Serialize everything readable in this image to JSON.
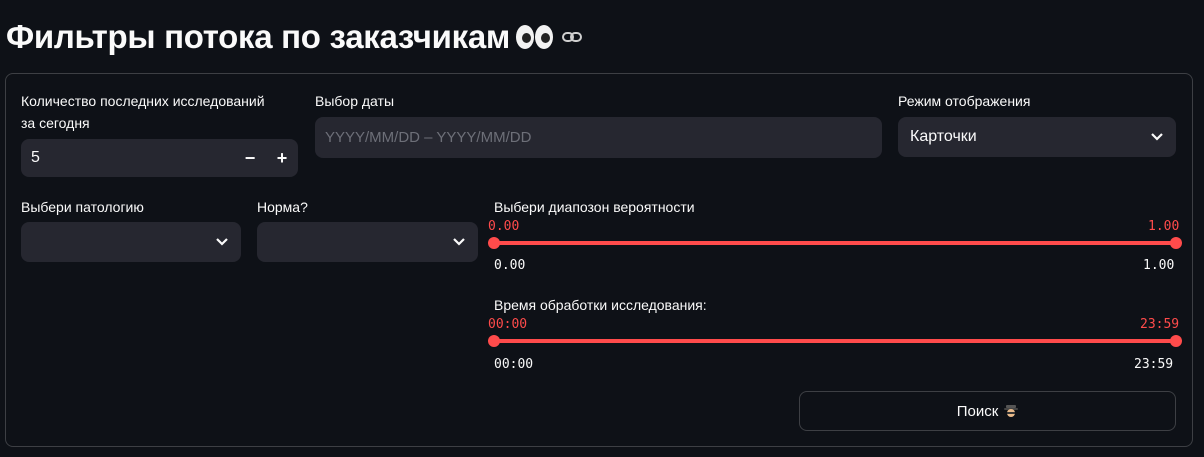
{
  "header": {
    "title": "Фильтры потока по заказчикам",
    "emoji_icon": "eyes-icon",
    "link_icon": "link-icon"
  },
  "filters": {
    "count": {
      "label": "Количество последних исследований за сегодня",
      "value": "5",
      "minus": "−",
      "plus": "+"
    },
    "date": {
      "label": "Выбор даты",
      "placeholder": "YYYY/MM/DD – YYYY/MM/DD"
    },
    "mode": {
      "label": "Режим отображения",
      "value": "Карточки"
    },
    "pathology": {
      "label": "Выбери патологию",
      "value": ""
    },
    "norm": {
      "label": "Норма?",
      "value": ""
    },
    "probability": {
      "label": "Выбери диапозон вероятности",
      "value_low": "0.00",
      "value_high": "1.00",
      "min": "0.00",
      "max": "1.00",
      "low_fraction": 0,
      "high_fraction": 1
    },
    "time": {
      "label": "Время обработки исследования:",
      "value_low": "00:00",
      "value_high": "23:59",
      "min": "00:00",
      "max": "23:59",
      "low_fraction": 0,
      "high_fraction": 1
    }
  },
  "search_button": {
    "label": "Поиск",
    "icon": "detective-icon"
  },
  "colors": {
    "accent": "#ff4b4b",
    "background": "#0e1117",
    "input_bg": "#262730"
  }
}
